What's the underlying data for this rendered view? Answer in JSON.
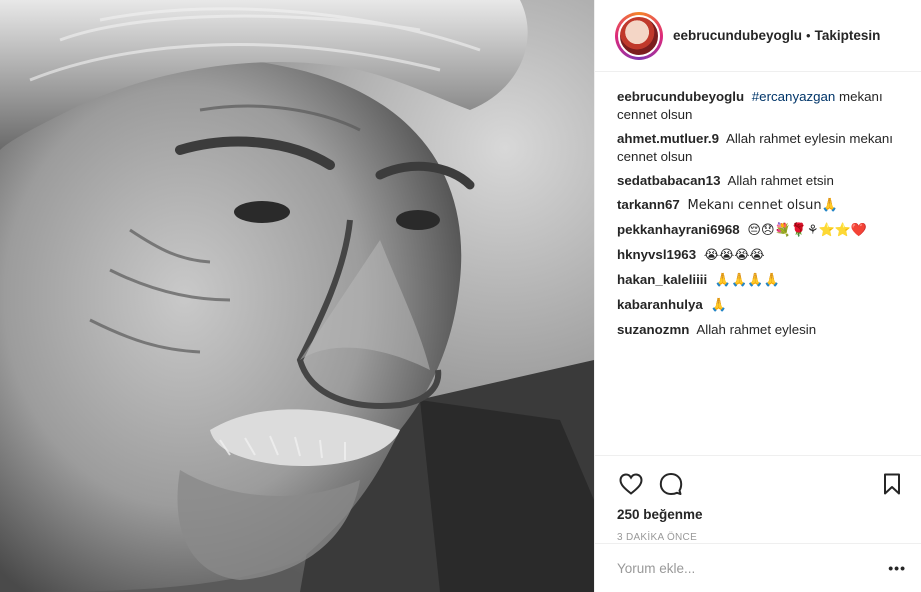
{
  "post": {
    "author": "eebrucundubeyoglu",
    "separator": "•",
    "follow_label": "Takiptesin",
    "caption": {
      "user": "eebrucundubeyoglu",
      "hashtag": "#ercanyazgan",
      "text": "mekanı cennet olsun"
    },
    "comments": [
      {
        "user": "ahmet.mutluer.9",
        "text": "Allah rahmet eylesin mekanı cennet olsun"
      },
      {
        "user": "sedatbabacan13",
        "text": "Allah rahmet etsin"
      },
      {
        "user": "tarkann67",
        "text": "Mekanı cennet olsun🙏"
      },
      {
        "user": "pekkanhayrani6968",
        "text": "😔😞💐🌹⚘⭐⭐❤️"
      },
      {
        "user": "hknyvsl1963",
        "text": "😭😭😭😭"
      },
      {
        "user": "hakan_kaleliiii",
        "text": "🙏🙏🙏🙏"
      },
      {
        "user": "kabaranhulya",
        "text": "🙏"
      },
      {
        "user": "suzanozmn",
        "text": "Allah rahmet eylesin"
      }
    ],
    "likes": "250 beğenme",
    "time": "3 DAKİKA ÖNCE",
    "comment_placeholder": "Yorum ekle...",
    "more_label": "•••"
  },
  "icons": {
    "like": "heart-icon",
    "comment": "comment-bubble-icon",
    "save": "bookmark-icon"
  },
  "colors": {
    "hashtag": "#003569",
    "text": "#262626",
    "muted": "#999999",
    "border": "#efefef"
  }
}
